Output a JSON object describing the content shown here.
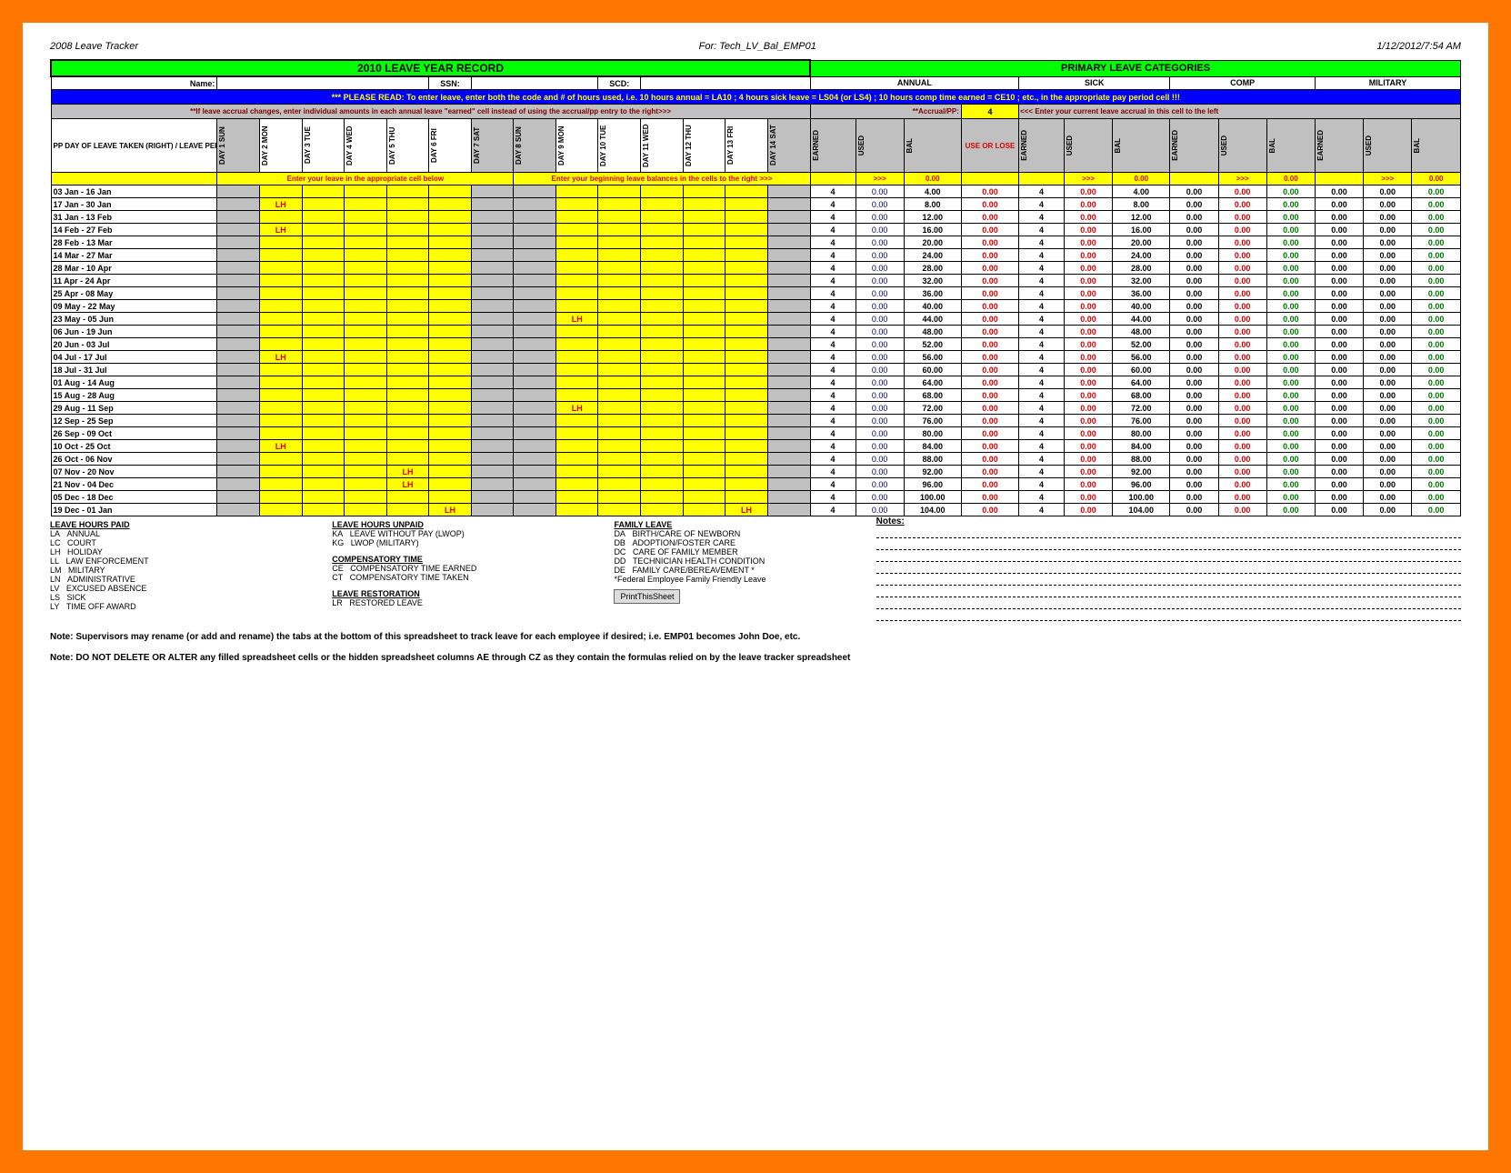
{
  "header": {
    "left": "2008 Leave Tracker",
    "center": "For: Tech_LV_Bal_EMP01",
    "right": "1/12/2012/7:54 AM"
  },
  "title": "2010 LEAVE YEAR RECORD",
  "categories": "PRIMARY LEAVE CATEGORIES",
  "labels": {
    "name": "Name:",
    "ssn": "SSN:",
    "scd": "SCD:",
    "accrual": "**Accrual/PP:",
    "accrualVal": "4",
    "enterAccrual": "<<< Enter your current leave accrual in this cell to the left"
  },
  "read": "*** PLEASE READ: To enter leave, enter both the code and # of hours used, i.e. 10 hours annual = LA10 ; 4 hours sick leave = LS04 (or LS4) ; 10 hours comp time earned = CE10 ; etc., in the appropriate pay period cell !!!",
  "accrNote": "**If leave accrual changes, enter individual amounts in each annual leave \"earned\" cell instead of using the accrual/pp entry to the right>>>",
  "ppHeader": "PP DAY OF LEAVE TAKEN (RIGHT) / LEAVE PERIOD (BELOW)",
  "days": [
    "DAY 1 SUN",
    "DAY 2 MON",
    "DAY 3 TUE",
    "DAY 4 WED",
    "DAY 5 THU",
    "DAY 6 FRI",
    "DAY 7 SAT",
    "DAY 8 SUN",
    "DAY 9 MON",
    "DAY 10 TUE",
    "DAY 11 WED",
    "DAY 12 THU",
    "DAY 13 FRI",
    "DAY 14 SAT"
  ],
  "groups": [
    "ANNUAL",
    "SICK",
    "COMP",
    "MILITARY"
  ],
  "sub": [
    "EARNED",
    "USED",
    "BAL",
    "USE OR LOSE",
    "EARNED",
    "USED",
    "BAL",
    "EARNED",
    "USED",
    "BAL",
    "EARNED",
    "USED",
    "BAL"
  ],
  "entL": "Enter your leave in the appropriate cell below",
  "entR": "Enter your beginning leave balances in the cells to the right >>>",
  "rows": [
    {
      "d": "03 Jan - 16 Jan",
      "lh": [],
      "a": [
        4,
        "0.00",
        "4.00",
        "0.00"
      ],
      "s": [
        4,
        "0.00",
        "4.00"
      ],
      "c": [
        "0.00",
        "0.00",
        "0.00"
      ],
      "m": [
        "0.00",
        "0.00",
        "0.00"
      ]
    },
    {
      "d": "17 Jan - 30 Jan",
      "lh": [
        1
      ],
      "a": [
        4,
        "0.00",
        "8.00",
        "0.00"
      ],
      "s": [
        4,
        "0.00",
        "8.00"
      ],
      "c": [
        "0.00",
        "0.00",
        "0.00"
      ],
      "m": [
        "0.00",
        "0.00",
        "0.00"
      ]
    },
    {
      "d": "31 Jan - 13 Feb",
      "lh": [],
      "a": [
        4,
        "0.00",
        "12.00",
        "0.00"
      ],
      "s": [
        4,
        "0.00",
        "12.00"
      ],
      "c": [
        "0.00",
        "0.00",
        "0.00"
      ],
      "m": [
        "0.00",
        "0.00",
        "0.00"
      ]
    },
    {
      "d": "14 Feb - 27 Feb",
      "lh": [
        1
      ],
      "a": [
        4,
        "0.00",
        "16.00",
        "0.00"
      ],
      "s": [
        4,
        "0.00",
        "16.00"
      ],
      "c": [
        "0.00",
        "0.00",
        "0.00"
      ],
      "m": [
        "0.00",
        "0.00",
        "0.00"
      ]
    },
    {
      "d": "28 Feb - 13 Mar",
      "lh": [],
      "a": [
        4,
        "0.00",
        "20.00",
        "0.00"
      ],
      "s": [
        4,
        "0.00",
        "20.00"
      ],
      "c": [
        "0.00",
        "0.00",
        "0.00"
      ],
      "m": [
        "0.00",
        "0.00",
        "0.00"
      ]
    },
    {
      "d": "14 Mar - 27 Mar",
      "lh": [],
      "a": [
        4,
        "0.00",
        "24.00",
        "0.00"
      ],
      "s": [
        4,
        "0.00",
        "24.00"
      ],
      "c": [
        "0.00",
        "0.00",
        "0.00"
      ],
      "m": [
        "0.00",
        "0.00",
        "0.00"
      ]
    },
    {
      "d": "28 Mar - 10 Apr",
      "lh": [],
      "a": [
        4,
        "0.00",
        "28.00",
        "0.00"
      ],
      "s": [
        4,
        "0.00",
        "28.00"
      ],
      "c": [
        "0.00",
        "0.00",
        "0.00"
      ],
      "m": [
        "0.00",
        "0.00",
        "0.00"
      ]
    },
    {
      "d": "11 Apr - 24 Apr",
      "lh": [],
      "a": [
        4,
        "0.00",
        "32.00",
        "0.00"
      ],
      "s": [
        4,
        "0.00",
        "32.00"
      ],
      "c": [
        "0.00",
        "0.00",
        "0.00"
      ],
      "m": [
        "0.00",
        "0.00",
        "0.00"
      ]
    },
    {
      "d": "25 Apr - 08 May",
      "lh": [],
      "a": [
        4,
        "0.00",
        "36.00",
        "0.00"
      ],
      "s": [
        4,
        "0.00",
        "36.00"
      ],
      "c": [
        "0.00",
        "0.00",
        "0.00"
      ],
      "m": [
        "0.00",
        "0.00",
        "0.00"
      ]
    },
    {
      "d": "09 May - 22 May",
      "lh": [],
      "a": [
        4,
        "0.00",
        "40.00",
        "0.00"
      ],
      "s": [
        4,
        "0.00",
        "40.00"
      ],
      "c": [
        "0.00",
        "0.00",
        "0.00"
      ],
      "m": [
        "0.00",
        "0.00",
        "0.00"
      ]
    },
    {
      "d": "23 May - 05 Jun",
      "lh": [
        8
      ],
      "a": [
        4,
        "0.00",
        "44.00",
        "0.00"
      ],
      "s": [
        4,
        "0.00",
        "44.00"
      ],
      "c": [
        "0.00",
        "0.00",
        "0.00"
      ],
      "m": [
        "0.00",
        "0.00",
        "0.00"
      ]
    },
    {
      "d": "06 Jun - 19 Jun",
      "lh": [],
      "a": [
        4,
        "0.00",
        "48.00",
        "0.00"
      ],
      "s": [
        4,
        "0.00",
        "48.00"
      ],
      "c": [
        "0.00",
        "0.00",
        "0.00"
      ],
      "m": [
        "0.00",
        "0.00",
        "0.00"
      ]
    },
    {
      "d": "20 Jun - 03 Jul",
      "lh": [],
      "a": [
        4,
        "0.00",
        "52.00",
        "0.00"
      ],
      "s": [
        4,
        "0.00",
        "52.00"
      ],
      "c": [
        "0.00",
        "0.00",
        "0.00"
      ],
      "m": [
        "0.00",
        "0.00",
        "0.00"
      ]
    },
    {
      "d": "04 Jul - 17 Jul",
      "lh": [
        1
      ],
      "a": [
        4,
        "0.00",
        "56.00",
        "0.00"
      ],
      "s": [
        4,
        "0.00",
        "56.00"
      ],
      "c": [
        "0.00",
        "0.00",
        "0.00"
      ],
      "m": [
        "0.00",
        "0.00",
        "0.00"
      ]
    },
    {
      "d": "18 Jul - 31 Jul",
      "lh": [],
      "a": [
        4,
        "0.00",
        "60.00",
        "0.00"
      ],
      "s": [
        4,
        "0.00",
        "60.00"
      ],
      "c": [
        "0.00",
        "0.00",
        "0.00"
      ],
      "m": [
        "0.00",
        "0.00",
        "0.00"
      ]
    },
    {
      "d": "01 Aug - 14 Aug",
      "lh": [],
      "a": [
        4,
        "0.00",
        "64.00",
        "0.00"
      ],
      "s": [
        4,
        "0.00",
        "64.00"
      ],
      "c": [
        "0.00",
        "0.00",
        "0.00"
      ],
      "m": [
        "0.00",
        "0.00",
        "0.00"
      ]
    },
    {
      "d": "15 Aug - 28 Aug",
      "lh": [],
      "a": [
        4,
        "0.00",
        "68.00",
        "0.00"
      ],
      "s": [
        4,
        "0.00",
        "68.00"
      ],
      "c": [
        "0.00",
        "0.00",
        "0.00"
      ],
      "m": [
        "0.00",
        "0.00",
        "0.00"
      ]
    },
    {
      "d": "29 Aug - 11 Sep",
      "lh": [
        8
      ],
      "a": [
        4,
        "0.00",
        "72.00",
        "0.00"
      ],
      "s": [
        4,
        "0.00",
        "72.00"
      ],
      "c": [
        "0.00",
        "0.00",
        "0.00"
      ],
      "m": [
        "0.00",
        "0.00",
        "0.00"
      ]
    },
    {
      "d": "12 Sep - 25 Sep",
      "lh": [],
      "a": [
        4,
        "0.00",
        "76.00",
        "0.00"
      ],
      "s": [
        4,
        "0.00",
        "76.00"
      ],
      "c": [
        "0.00",
        "0.00",
        "0.00"
      ],
      "m": [
        "0.00",
        "0.00",
        "0.00"
      ]
    },
    {
      "d": "26 Sep - 09 Oct",
      "lh": [],
      "a": [
        4,
        "0.00",
        "80.00",
        "0.00"
      ],
      "s": [
        4,
        "0.00",
        "80.00"
      ],
      "c": [
        "0.00",
        "0.00",
        "0.00"
      ],
      "m": [
        "0.00",
        "0.00",
        "0.00"
      ]
    },
    {
      "d": "10 Oct - 25 Oct",
      "lh": [
        1
      ],
      "a": [
        4,
        "0.00",
        "84.00",
        "0.00"
      ],
      "s": [
        4,
        "0.00",
        "84.00"
      ],
      "c": [
        "0.00",
        "0.00",
        "0.00"
      ],
      "m": [
        "0.00",
        "0.00",
        "0.00"
      ]
    },
    {
      "d": "26 Oct - 06 Nov",
      "lh": [],
      "a": [
        4,
        "0.00",
        "88.00",
        "0.00"
      ],
      "s": [
        4,
        "0.00",
        "88.00"
      ],
      "c": [
        "0.00",
        "0.00",
        "0.00"
      ],
      "m": [
        "0.00",
        "0.00",
        "0.00"
      ]
    },
    {
      "d": "07 Nov - 20 Nov",
      "lh": [
        4
      ],
      "a": [
        4,
        "0.00",
        "92.00",
        "0.00"
      ],
      "s": [
        4,
        "0.00",
        "92.00"
      ],
      "c": [
        "0.00",
        "0.00",
        "0.00"
      ],
      "m": [
        "0.00",
        "0.00",
        "0.00"
      ]
    },
    {
      "d": "21 Nov - 04 Dec",
      "lh": [
        4
      ],
      "a": [
        4,
        "0.00",
        "96.00",
        "0.00"
      ],
      "s": [
        4,
        "0.00",
        "96.00"
      ],
      "c": [
        "0.00",
        "0.00",
        "0.00"
      ],
      "m": [
        "0.00",
        "0.00",
        "0.00"
      ]
    },
    {
      "d": "05 Dec - 18 Dec",
      "lh": [],
      "a": [
        4,
        "0.00",
        "100.00",
        "0.00"
      ],
      "s": [
        4,
        "0.00",
        "100.00"
      ],
      "c": [
        "0.00",
        "0.00",
        "0.00"
      ],
      "m": [
        "0.00",
        "0.00",
        "0.00"
      ]
    },
    {
      "d": "19 Dec - 01 Jan",
      "lh": [
        5,
        12
      ],
      "a": [
        4,
        "0.00",
        "104.00",
        "0.00"
      ],
      "s": [
        4,
        "0.00",
        "104.00"
      ],
      "c": [
        "0.00",
        "0.00",
        "0.00"
      ],
      "m": [
        "0.00",
        "0.00",
        "0.00"
      ]
    }
  ],
  "legend": {
    "c1h": "LEAVE HOURS PAID",
    "c1": [
      [
        "LA",
        "ANNUAL"
      ],
      [
        "LC",
        "COURT"
      ],
      [
        "LH",
        "HOLIDAY"
      ],
      [
        "LL",
        "LAW ENFORCEMENT"
      ],
      [
        "LM",
        "MILITARY"
      ],
      [
        "LN",
        "ADMINISTRATIVE"
      ],
      [
        "LV",
        "EXCUSED ABSENCE"
      ],
      [
        "LS",
        "SICK"
      ],
      [
        "LY",
        "TIME OFF AWARD"
      ]
    ],
    "c2h": "LEAVE HOURS UNPAID",
    "c2": [
      [
        "KA",
        "LEAVE WITHOUT PAY (LWOP)"
      ],
      [
        "KG",
        "LWOP (MILITARY)"
      ]
    ],
    "c3h": "COMPENSATORY TIME",
    "c3": [
      [
        "CE",
        "COMPENSATORY TIME EARNED"
      ],
      [
        "CT",
        "COMPENSATORY TIME TAKEN"
      ]
    ],
    "c3bh": "LEAVE RESTORATION",
    "c3b": [
      [
        "LR",
        "RESTORED LEAVE"
      ]
    ],
    "c4h": "FAMILY LEAVE",
    "c4": [
      [
        "DA",
        "BIRTH/CARE OF NEWBORN"
      ],
      [
        "DB",
        "ADOPTION/FOSTER CARE"
      ],
      [
        "DC",
        "CARE OF FAMILY MEMBER"
      ],
      [
        "DD",
        "TECHNICIAN HEALTH CONDITION"
      ],
      [
        "DE",
        "FAMILY CARE/BEREAVEMENT *"
      ],
      [
        "",
        "*Federal Employee Family Friendly Leave"
      ]
    ],
    "btn": "PrintThisSheet",
    "notes": "Notes:"
  },
  "footer1": "Note:  Supervisors may rename (or add and rename) the tabs at the bottom of this spreadsheet to track leave for each employee if desired; i.e. EMP01 becomes John Doe, etc.",
  "footer2": "Note: DO NOT DELETE OR ALTER any filled spreadsheet cells or the hidden spreadsheet columns AE through CZ as they contain the formulas relied on by the leave tracker spreadsheet"
}
